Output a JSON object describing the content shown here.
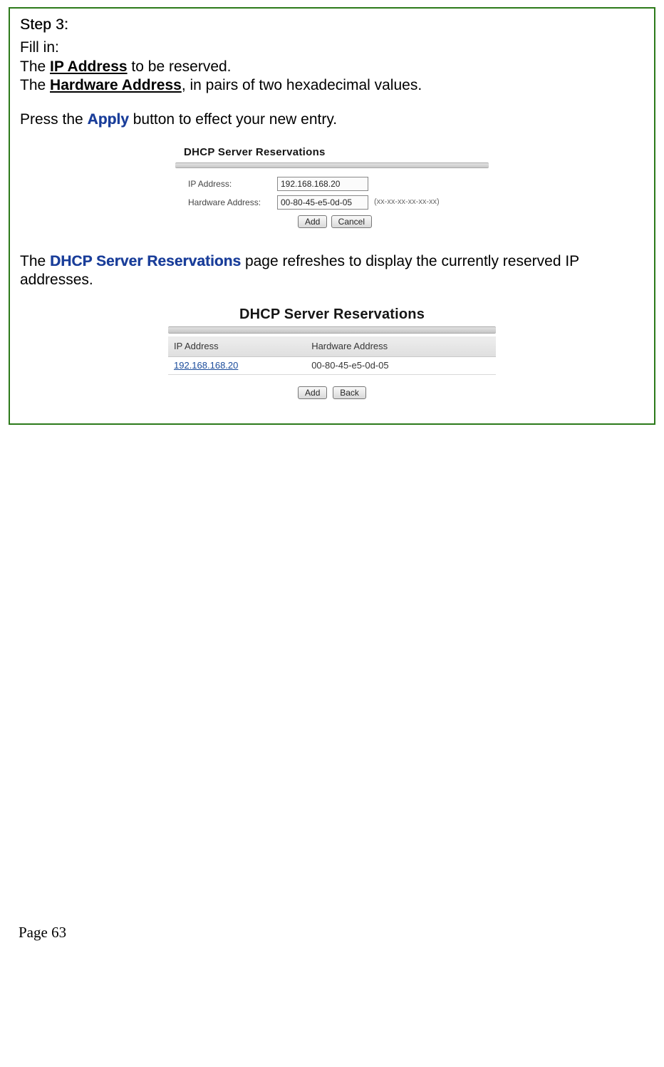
{
  "step_label": "Step 3:",
  "fillin_intro": "Fill in:",
  "line_ip_pre": "The ",
  "ip_bold": "IP Address",
  "line_ip_post": " to be reserved.",
  "line_hw_pre": "The ",
  "hw_bold": "Hardware Address",
  "line_hw_post": ", in pairs of two hexadecimal values.",
  "press_pre": "Press the ",
  "apply_word": "Apply",
  "press_post": " button to effect your new entry.",
  "shot1": {
    "title": "DHCP Server Reservations",
    "ip_label": "IP Address:",
    "ip_value": "192.168.168.20",
    "hw_label": "Hardware Address:",
    "hw_value": "00-80-45-e5-0d-05",
    "hw_hint": "(xx-xx-xx-xx-xx-xx)",
    "add_btn": "Add",
    "cancel_btn": "Cancel"
  },
  "refresh_pre": "The ",
  "dhcp_bold": "DHCP Server Reservations",
  "refresh_post": " page refreshes to display the currently reserved IP addresses.",
  "shot2": {
    "title": "DHCP Server Reservations",
    "col_ip": "IP Address",
    "col_hw": "Hardware Address",
    "row_ip": "192.168.168.20",
    "row_hw": "00-80-45-e5-0d-05",
    "add_btn": "Add",
    "back_btn": "Back"
  },
  "page_num": "Page 63"
}
